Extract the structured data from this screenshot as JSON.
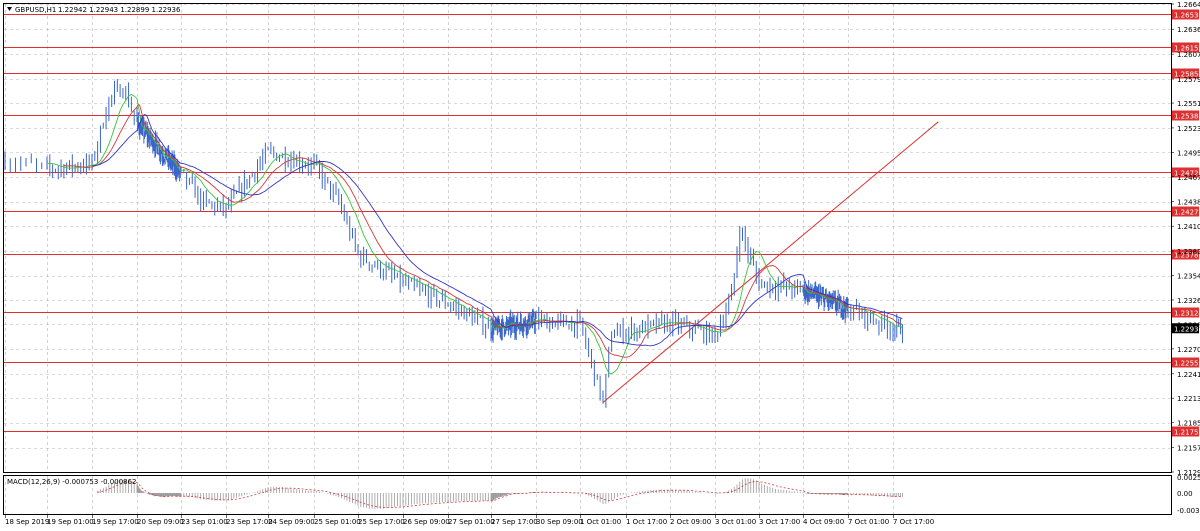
{
  "header": {
    "symbol": "GBPUSD,H1",
    "ohlc": "1.22942 1.22943 1.22899 1.22936"
  },
  "macd_label": "MACD(12,26,9) -0.000753 -0.000862",
  "colors": {
    "candle": "#3a66c8",
    "grid": "#b5b5b5",
    "level": "#dd3030",
    "ma_fast": "#39c339",
    "ma_mid": "#d23a3a",
    "ma_slow": "#3434c8",
    "macd_hist": "#9a9a9a",
    "macd_signal": "#d23a3a",
    "current_price_bg": "#000000"
  },
  "chart_data": {
    "type": "line",
    "title": "",
    "instrument": "GBPUSD",
    "timeframe": "H1",
    "price_axis": {
      "range": [
        1.2129,
        1.26649
      ],
      "ticks": [
        "1.26649",
        "1.26360",
        "1.26075",
        "1.25790",
        "1.25515",
        "1.25230",
        "1.24950",
        "1.24670",
        "1.24385",
        "1.24105",
        "1.23820",
        "1.23540",
        "1.23260",
        "1.22980",
        "1.22700",
        "1.22415",
        "1.22135",
        "1.21855",
        "1.21570",
        "1.21290"
      ]
    },
    "time_axis": {
      "ticks": [
        "18 Sep 2019",
        "19 Sep 01:00",
        "19 Sep 17:00",
        "20 Sep 09:00",
        "23 Sep 01:00",
        "23 Sep 17:00",
        "24 Sep 09:00",
        "25 Sep 01:00",
        "25 Sep 17:00",
        "26 Sep 09:00",
        "27 Sep 01:00",
        "27 Sep 17:00",
        "30 Sep 09:00",
        "1 Oct 01:00",
        "1 Oct 17:00",
        "2 Oct 09:00",
        "3 Oct 01:00",
        "3 Oct 17:00",
        "4 Oct 09:00",
        "7 Oct 01:00",
        "7 Oct 17:00"
      ]
    },
    "horizontal_levels": [
      "1.26539",
      "1.26157",
      "1.25854",
      "1.25382",
      "1.24727",
      "1.24275",
      "1.23787",
      "1.23124",
      "1.22555",
      "1.21759"
    ],
    "current_price": "1.22936",
    "trendline": {
      "from": [
        "1 Oct 09:00",
        1.22086
      ],
      "to": [
        "8 Oct 17:00",
        1.253
      ]
    },
    "price_series": {
      "name": "",
      "anchors": [
        [
          "18 Sep 2019",
          1.2486
        ],
        [
          "19 Sep 01:00",
          1.2476
        ],
        [
          "19 Sep 17:00",
          1.2482
        ],
        [
          "19 Sep 23:00",
          1.2555
        ],
        [
          "20 Sep 04:00",
          1.257
        ],
        [
          "20 Sep 09:00",
          1.2528
        ],
        [
          "23 Sep 01:00",
          1.247
        ],
        [
          "23 Sep 09:00",
          1.2437
        ],
        [
          "23 Sep 17:00",
          1.243
        ],
        [
          "24 Sep 09:00",
          1.2495
        ],
        [
          "25 Sep 01:00",
          1.248
        ],
        [
          "25 Sep 10:00",
          1.2438
        ],
        [
          "25 Sep 17:00",
          1.2378
        ],
        [
          "26 Sep 09:00",
          1.2345
        ],
        [
          "27 Sep 01:00",
          1.2322
        ],
        [
          "27 Sep 17:00",
          1.2293
        ],
        [
          "30 Sep 09:00",
          1.2302
        ],
        [
          "1 Oct 01:00",
          1.2298
        ],
        [
          "1 Oct 09:00",
          1.2209
        ],
        [
          "1 Oct 12:00",
          1.2288
        ],
        [
          "1 Oct 17:00",
          1.229
        ],
        [
          "2 Oct 09:00",
          1.23
        ],
        [
          "3 Oct 01:00",
          1.2285
        ],
        [
          "3 Oct 07:00",
          1.233
        ],
        [
          "3 Oct 10:00",
          1.2408
        ],
        [
          "3 Oct 17:00",
          1.2345
        ],
        [
          "4 Oct 09:00",
          1.2337
        ],
        [
          "7 Oct 01:00",
          1.2316
        ],
        [
          "7 Oct 17:00",
          1.2294
        ],
        [
          "7 Oct 22:00",
          1.22936
        ]
      ]
    },
    "moving_averages": [
      {
        "name": "",
        "color_key": "ma_fast",
        "periods": 8
      },
      {
        "name": "",
        "color_key": "ma_mid",
        "periods": 14
      },
      {
        "name": "",
        "color_key": "ma_slow",
        "periods": 24
      }
    ],
    "macd": {
      "params": "12,26,9",
      "main": -0.000753,
      "signal": -0.000862,
      "axis_ticks": [
        "0.002587",
        "0.00",
        "-0.003294"
      ],
      "range": [
        -0.003294,
        0.002587
      ]
    }
  }
}
